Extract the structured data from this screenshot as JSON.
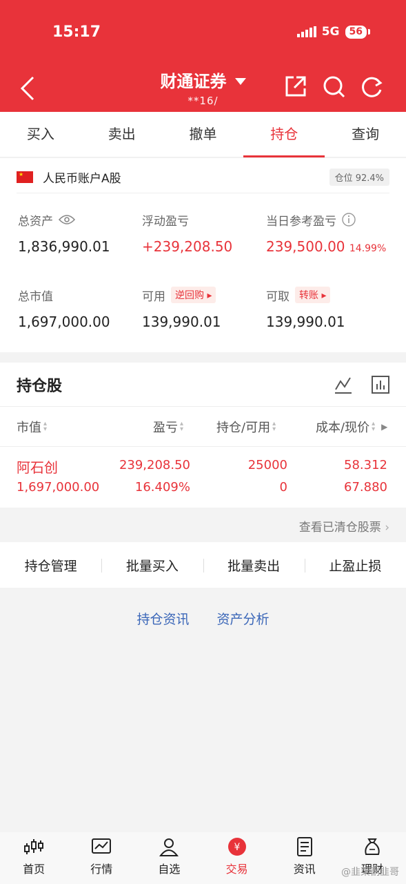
{
  "status_bar": {
    "time": "15:17",
    "network": "5G",
    "battery": "56"
  },
  "header": {
    "title": "财通证券",
    "account_masked": "**16/",
    "back_icon": "chevron-left-icon",
    "share_icon": "share-icon",
    "search_icon": "search-icon",
    "refresh_icon": "refresh-icon"
  },
  "tabs": [
    {
      "label": "买入"
    },
    {
      "label": "卖出"
    },
    {
      "label": "撤单"
    },
    {
      "label": "持仓",
      "active": true
    },
    {
      "label": "查询"
    }
  ],
  "account": {
    "label": "人民币账户A股",
    "position_badge": "仓位 92.4%"
  },
  "summary": {
    "total_assets": {
      "label": "总资产",
      "value": "1,836,990.01"
    },
    "floating_pl": {
      "label": "浮动盈亏",
      "value": "+239,208.50"
    },
    "daily_pl": {
      "label": "当日参考盈亏",
      "value": "239,500.00",
      "pct": "14.99%"
    },
    "market_value": {
      "label": "总市值",
      "value": "1,697,000.00"
    },
    "available": {
      "label": "可用",
      "tag": "逆回购",
      "value": "139,990.01"
    },
    "withdrawable": {
      "label": "可取",
      "tag": "转账",
      "value": "139,990.01"
    }
  },
  "holdings": {
    "title": "持仓股",
    "columns": [
      "市值",
      "盈亏",
      "持仓/可用",
      "成本/现价"
    ],
    "rows": [
      {
        "name": "阿石创",
        "market_value": "1,697,000.00",
        "pl": "239,208.50",
        "pl_pct": "16.409%",
        "holding": "25000",
        "available": "0",
        "cost": "58.312",
        "price": "67.880"
      }
    ],
    "cleared_link": "查看已清仓股票"
  },
  "actions": [
    "持仓管理",
    "批量买入",
    "批量卖出",
    "止盈止损"
  ],
  "links": [
    "持仓资讯",
    "资产分析"
  ],
  "bottom_nav": [
    {
      "label": "首页",
      "icon": "candlestick-icon"
    },
    {
      "label": "行情",
      "icon": "chart-icon"
    },
    {
      "label": "自选",
      "icon": "user-icon"
    },
    {
      "label": "交易",
      "icon": "yuan-icon",
      "active": true
    },
    {
      "label": "资讯",
      "icon": "document-icon"
    },
    {
      "label": "理财",
      "icon": "money-bag-icon"
    }
  ],
  "watermark": "@韭菜割韭哥",
  "colors": {
    "brand_red": "#e8333a",
    "link_blue": "#3a66b8"
  }
}
